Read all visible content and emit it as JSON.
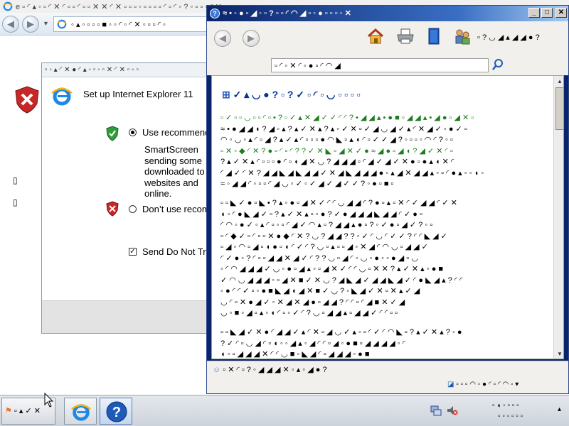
{
  "ie_window": {
    "title": "e ▫ ◜ ▴ ◦ ▫ ◜ ✕ ◜ ▫ ▫ ◜ ▫ ▫ ✕ ✕ ◜ ✕ ▫ ▫ ▫ ◦ ▫ ▫ ▫ ▫ ◜ ▫ ◜ ◦ ? ◦ ▫ ▫ ◦ ◜ ✕",
    "address": "◦ ▴ ◦ ▫ ▫ ▫ ■ ◦ ◦ ◜ ◦ ◜ ✕ ◦ ▫ ▫ ◜ ◦",
    "content_heading": "▫ ▫ ◦ ▴ ◜ ✕ ◜ ▫ ◦ ? ◦ ▫ ◦ ✕ ◜ ▫",
    "side_marks": [
      "▯",
      "▯"
    ]
  },
  "setup_dialog": {
    "titlebar": "▫ ◦ ▴ ◜ ✕ ● ◜ ▴ ◦ ▫ ◦ ▫ ✕ ◜ ✕ ▫ ◦ ▫",
    "title": "Set up Internet Explorer 11",
    "use_recommended": "Use recommended security and compatibility settings",
    "smartscreen_lines": [
      "SmartScreen",
      "sending some",
      "downloaded to",
      "websites and",
      "online."
    ],
    "dont_use": "Don’t use recommended settings",
    "send_do_not_track": "Send Do Not Track requests"
  },
  "help_window": {
    "title": "≈ • ◦ ● ▫ ◢ ◦ ▫ ? ▫ ▫ ◜ ◠ ◢ ▫ ◦ ● ▫ ▫ ▫ ◦ ✕",
    "min_glyph": "_",
    "max_glyph": "□",
    "close_glyph": "✕",
    "back_glyph": "◀",
    "forward_glyph": "▶",
    "options_label": "▫ ? ◡ ◢ ▴ ◢ ◢ ● ?",
    "search_text": "▫ ◜ ◦ ✕ ◜ ◦ ● ▫ ◜ ◠ ◢",
    "article_title": "✓ ▴ ◡ ● ? ▫ ? ✓ ▫ ◜ ▫ ◡ ▫ ▫ ▫ ▫",
    "paragraphs": [
      {
        "lines": [
          {
            "text": "▫ ✓ ▫ ▫ ◡ ▫ ▫ ◜ ▫ • ? ▫ ✓ ▴ ✕ ◢ ✓ ✓ ◜ ◜ ? • ◢ ◢ ▴ • ● ■ ▫ ◢ ◢ ▴ • ◢ ● ▫ ◢ ✕ ▫",
            "green": true
          },
          {
            "text": "≈ • ● ◢ ◢ ◖ ? ◢ ◦ ▴ ? ▴ ✓ ✕ ▴ ? ▴ ◦ ✓ ✕ ▫ ✓ ◢ ◡ ◢ ✓ ▴ ◜ ✕ ◢ ✓ ◦ ● ✓ ▫",
            "green": false
          },
          {
            "text": "◠ ◦ ◡ ◦ ▴ ◜ ▫ ◢ ? ▴ ✓ ▴ ◜ ▫ ▫ ▫ ● ◠ ◣ ▫ ▴ ◖ ◜ ▫ ✓ ✓ ◢ ? ◦ ▫ ▫ ◦ ◠ ◜ ? ◦ ▫",
            "green": false
          },
          {
            "text": "▫ ✕ ◦ ◆ ◜ ✕ ? ● ▫ ◜ ▫ ◜ ? ? ✓ ✕ ◣ ▫ ◢ ✕ ✓ ● ≈ ◢ ● ▫ ◢ ◖ ? ◢ ✓ ✕ ◜ ▫",
            "green": true
          },
          {
            "text": "? ▴ ✓ ✕ ▴ ◜ ▫ ▫ ▫ ● ◜ ▫ ◖ ◢ ✕ ◡ ? ◢ ◢ ◢ ▫ ◜ ◢ ✓ ◢ ✓ ✕ ● ▫ ● ▴ ◖ ✕ ◜",
            "green": false
          },
          {
            "text": "◜ ◢ ✓ ◜ ✕ ? ◢ ◢ ◣ ◢ ◣ ◢ ◢ ✓ ✕ ◢ ◣ ◢ ◢ ◢ ● ◦ ▴ ◢ ✕ ◢ ◢ ▴ ◦ ▫ ◜ ● ▴ ◦ ◦ ◖ ◦",
            "green": false
          },
          {
            "text": "≈ ◦ ◢ ◢ ◜ ◦ ▫ ▫ ◜ ◢ ◡ ◦ ✓ ◦ ✓ ◢ ✓ ◢ ✓ ✓ ? ◦ ● ▫ ■ ▫",
            "green": false
          }
        ]
      },
      {
        "lines": [
          {
            "text": "▫ ▫ ◣ ✓ ● ▫ ◣ • ? ▴ ◦ ● ▫ ◢ ✕ ✓ ◜ ◜ ◡ ◢ ◢ ◜ ? ● ▫ ▴ ▫ ✕ ◜ ✓ ◢ ◢ ◜ ✓ ✕",
            "green": false
          },
          {
            "text": "◖ ◦ ◜ ● ◣ ◢ ✓ ▫ ? ▴ ✓ ✕ ▴ ▫ ◦ ● ? ✓ ● ◢ ◢ ◢ ◣ ◢ ◢ ◜ ✓ ● ▫",
            "green": false
          },
          {
            "text": "◜ ◠ ◦ ● ✓ ◦ ▴ ◜ ▫ ◦ ▫ ◜ ◢ ✓ ◠ ▴ ▫ ? ◢ ◢ ▴ ● ▫ ? ◦ ✓ ● ▫ ◢ ✓ ? ◦ ▫",
            "green": false
          },
          {
            "text": "▫ ◜ ◆ ✓ ▫ ◜ ▫ ▫ ✕ ● ◆ ◜ ✕ ? ◡ ? ◢ ◢ ? ? ◦ ✓ ◜ ◡ ◜ ✓ ✓ ? ◜ ◜ ◣ ◢ ✓",
            "green": false
          },
          {
            "text": "▫ ◢ ◦ ◠ ▫ ◢ ▫ ◖ ● ▫ ◖ ◜ ✓ ◜ ? ◡ ▫ ▴ ▫ ▫ ◢ ◦ ✕ ◢ ◜ ◠ ◡ ▫ ◢ ◢ ✓",
            "green": false
          },
          {
            "text": "◜ ✓ ● ◦ ? ◜ ▫ ▫ ◢ ◢ ✕ ◢ ✓ ◜ ? ? ◡ ▫ ◢ ◜ ◦ ◡ ◦ ● ◦ ◦ ● ◢ ▫ ◡",
            "green": false
          },
          {
            "text": "◦ ◜ ◠ ◢ ◢ ◢ ✓ ◡ ◦ ● ▫ ◢ ▴ ◦ ▫ ◢ ✕ ✓ ◜ ◜ ◡ ▫ ✕ ✕ ? ▴ ✓ ✕ ▴ ◦ ● ■",
            "green": false
          },
          {
            "text": "✓ ◠ ◡ ◢ ◢ ◢ ◦ ▫ ◢ ✕ ■ ✓ ✕ ◡ ? ◢ ◣ ◢ ✓ ◢ ◢ ◣ ◢ ✓ ◜ ● ◣ ◢ ▴ ? ◜ ◜",
            "green": false
          },
          {
            "text": "◦ ● ◜ ◜ ✓ ▫ ◦ ● ■ ◣ ◢ ◖ ◢ ✕ ■ ✓ ◡ ? ◦ ◣ ◢ ✓ ✕ ▫ ✕ ▴ ✓ ◢",
            "green": false
          },
          {
            "text": "◡ ◜ ▫ ✕ ● ◢ ✓ ◦ ✕ ◢ ✕ ◢ ● ▫ ◢ ◢ ? ◜ ◜ ▫ ◜ ◢ ■ ✕ ✓ ◢",
            "green": false
          },
          {
            "text": "◡ ◦ ■ ◦ ◢ ▫ ▴ ◦ ◖ ◜ ▫ ◦ ✓ ◜ ? ◡ ▫ ◢ ◢ ▴ ▫ ◢ ◢ ✓ ◜ ◜ ▫ ▫",
            "green": false
          }
        ]
      },
      {
        "lines": [
          {
            "text": "▫ ▫ ◣ ◢ ✓ ✕ ● ◜ ◢ ◢ ✓ ▴ ◜ ✕ ▫ ◢ ◡ ✓ ▴ ◦ ▫ ◜ ✓ ◜ ◠ ◣ ▫ ? ▴ ✓ ✕ ▴ ? ◦ ●",
            "green": false
          },
          {
            "text": "? ✓ ◜ ▫ ◡ ◢ ◜ ▫ ◖ ◦ ◦ ◢ ▴ ◦ ◢ ◜ ◜ ▫ ◢ ◦ ● ■ ▫ ◢ ◢ ◢ ◢ ◦ ◜",
            "green": false
          },
          {
            "text": "◖ ◦ ▫ ◢ ◢ ◢ ✕ ◜ ◜ ◡ ■ ◦ ◣ ◢ ◜ ▫ ◢ ◢ ◢ ◦ ● ■",
            "green": false
          }
        ]
      }
    ],
    "ask_someone": "▫ ✕ ◜ ▫ ? ◦ ◢ ◢ ◢ ✕ ◦ ▴ ◦ ◢ ● ?",
    "online_status": "▫ ▫ ▫ ◠ ◦ ● ◜ ▫ ◜ ◠ ◦"
  },
  "taskbar": {
    "start_label": "▫ ▴ ✓ ✕",
    "time": "▫ ◖ ◦ ▫ ▫ ▫",
    "date": "▫ ◦ ◦ ▫ ▫ ▫",
    "show_desktop_glyph": "▴"
  }
}
